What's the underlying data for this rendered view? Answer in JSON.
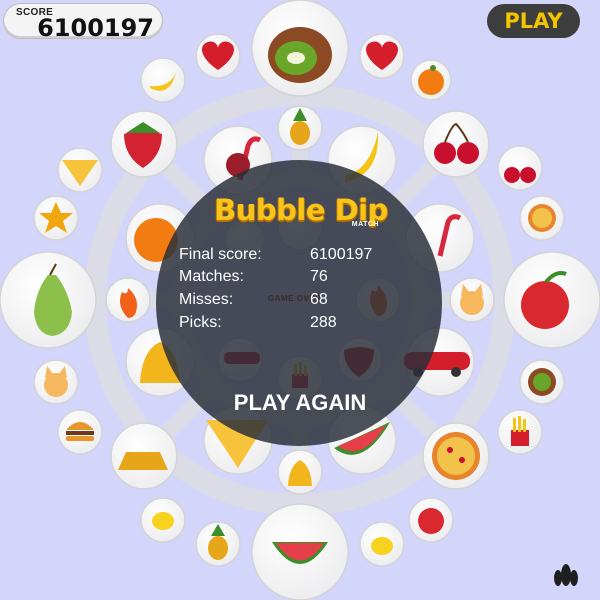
{
  "hud": {
    "score_label": "SCORE",
    "score_value": "6100197",
    "play_label": "PLAY"
  },
  "game_over": {
    "logo_title": "Bubble Dip",
    "logo_subtitle": "MATCH",
    "stats": [
      {
        "label": "Final score:",
        "value": "6100197"
      },
      {
        "label": "Matches:",
        "value": "76"
      },
      {
        "label": "Misses:",
        "value": "68"
      },
      {
        "label": "Picks:",
        "value": "288"
      }
    ],
    "faint_text": "GAME OVER",
    "play_again_label": "PLAY AGAIN"
  },
  "board_items": [
    "kiwi-icon",
    "heart-icon",
    "heart-icon",
    "banana-icon",
    "orange-icon",
    "strawberry-icon",
    "cherries-icon",
    "pineapple-icon",
    "candy-cane-icon",
    "banana-icon",
    "diamond-icon",
    "cherries-icon",
    "star-icon",
    "pizza-icon",
    "orange-icon",
    "candy-cane-icon",
    "pear-icon",
    "fire-icon",
    "fire-icon",
    "cat-icon",
    "apple-icon",
    "bell-icon",
    "strawberry-icon",
    "car-icon",
    "car-icon",
    "cat-icon",
    "kiwi-icon",
    "fries-icon",
    "burger-icon",
    "fries-icon",
    "diamond-icon",
    "watermelon-icon",
    "pizza-icon",
    "gold-bars-icon",
    "bell-icon",
    "lemon-icon",
    "pineapple-icon",
    "apple-icon",
    "lemon-icon",
    "watermelon-icon"
  ],
  "colors": {
    "background": "#d4d5fa",
    "play_text": "#f4c400",
    "logo": "#f9c51a"
  }
}
